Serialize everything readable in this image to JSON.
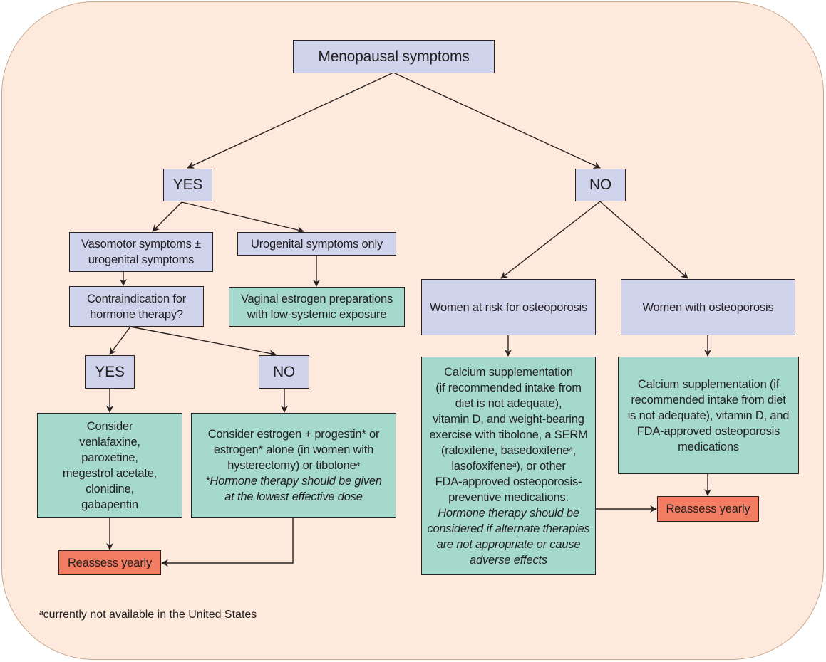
{
  "diagram": {
    "root": "Menopausal symptoms",
    "branch_yes": "YES",
    "branch_no": "NO",
    "vasomotor": [
      "Vasomotor symptoms ±",
      "urogenital symptoms"
    ],
    "urogenital_only": "Urogenital symptoms only",
    "contraindication": [
      "Contraindication for",
      "hormone therapy?"
    ],
    "vaginal_estrogen": [
      "Vaginal estrogen preparations",
      "with low-systemic exposure"
    ],
    "contra_yes": "YES",
    "contra_no": "NO",
    "nonhormonal": [
      "Consider",
      "venlafaxine,",
      "paroxetine,",
      "megestrol acetate,",
      "clonidine,",
      "gabapentin"
    ],
    "hormonal": {
      "lines": [
        "Consider estrogen + progestin* or",
        "estrogen* alone (in women with",
        "hysterectomy) or tibolone"
      ],
      "footnote_marker": "a",
      "note": [
        "*Hormone therapy should be given",
        "at the lowest effective dose"
      ]
    },
    "reassess_left": "Reassess yearly",
    "at_risk": "Women at risk for osteoporosis",
    "with_osteo": "Women with osteoporosis",
    "calcium_prevent": {
      "l1": "Calcium supplementation",
      "l2": "(if recommended intake from",
      "l3": "diet is not adequate),",
      "l4": "vitamin D, and weight-bearing",
      "l5": "exercise with tibolone, a SERM",
      "l6a": "(raloxifene, basedoxifene",
      "l6b": ",",
      "l7a": "lasofoxifene",
      "l7b": "), or other",
      "l8": "FDA-approved osteoporosis-",
      "l9": "preventive medications.",
      "marker": "a",
      "note": [
        "Hormone therapy should be",
        "considered if alternate therapies",
        "are not appropriate or cause",
        "adverse effects"
      ]
    },
    "calcium_treat": [
      "Calcium supplementation (if",
      "recommended intake from diet",
      "is not adequate), vitamin D, and",
      "FDA-approved osteoporosis",
      "medications"
    ],
    "reassess_right": "Reassess yearly",
    "footnote": {
      "marker": "a",
      "text": "currently not available in the United States"
    }
  },
  "colors": {
    "background": "#fdeadc",
    "question_box": "#d0d3ec",
    "action_box": "#a5d9cb",
    "reassess_box": "#f27d63"
  }
}
